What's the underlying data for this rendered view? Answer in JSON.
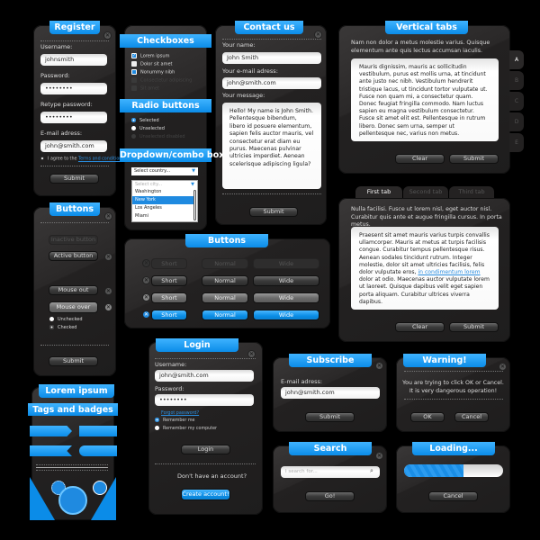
{
  "register": {
    "title": "Register",
    "username_label": "Username:",
    "username_value": "johnsmith",
    "password_label": "Password:",
    "password_value": "••••••••",
    "retype_label": "Retype password:",
    "retype_value": "••••••••",
    "email_label": "E-mail adress:",
    "email_value": "john@smith.com",
    "agree_text": "I agree to the",
    "terms_link": "Terms and conditions",
    "submit": "Submit"
  },
  "checkboxes": {
    "title": "Checkboxes",
    "items": [
      {
        "label": "Lorem ipsum",
        "checked": true,
        "disabled": false
      },
      {
        "label": "Dolor sit amet",
        "checked": false,
        "disabled": false
      },
      {
        "label": "Nonummy nibh",
        "checked": "partial",
        "disabled": false
      },
      {
        "label": "Consectetur adipiscing",
        "checked": false,
        "disabled": true
      },
      {
        "label": "Sit amet",
        "checked": true,
        "disabled": true
      }
    ]
  },
  "radios": {
    "title": "Radio buttons",
    "items": [
      {
        "label": "Selected",
        "selected": true,
        "disabled": false
      },
      {
        "label": "Unselected",
        "selected": false,
        "disabled": false
      },
      {
        "label": "Unselected disabled",
        "selected": false,
        "disabled": true
      }
    ]
  },
  "dropdown": {
    "title": "Dropdown/combo box",
    "country_value": "Select country...",
    "city_placeholder": "Select city...",
    "options": [
      "Washington",
      "New York",
      "Los Angeles",
      "Miami"
    ],
    "selected_option": "New York"
  },
  "contact": {
    "title": "Contact us",
    "name_label": "Your name:",
    "name_value": "John Smith",
    "email_label": "Your e-mail adress:",
    "email_value": "john@smith.com",
    "message_label": "Your message:",
    "message_value": "Hello! My name is John Smith. Pellentesque bibendum, libero id posuere elementum, sapien felis auctor mauris, vel consectetur erat diam eu purus. Maecenas pulvinar ultricies imperdiet. Aenean scelerisque adipiscing ligula?",
    "submit": "Submit"
  },
  "vertical_tabs": {
    "title": "Vertical tabs",
    "intro": "Nam non dolor a metus molestie varius. Quisque elementum ante quis lectus accumsan iaculis.",
    "body": "Mauris dignissim, mauris ac sollicitudin vestibulum, purus est mollis urna, at tincidunt ante justo nec nibh. Vestibulum hendrerit tristique lacus, ut tincidunt tortor vulputate ut. Fusce non quam mi, a consectetur quam. Donec feugiat fringilla commodo. Nam luctus sapien eu magna vestibulum consectetur. Fusce sit amet elit est. Pellentesque in rutrum libero. Donec sem urna, semper ut pellentesque nec, varius non metus.",
    "tabs": [
      "A",
      "B",
      "C",
      "D",
      "E"
    ],
    "active_tab": "A",
    "clear": "Clear",
    "submit": "Submit"
  },
  "horizontal_tabs": {
    "tabs": [
      "First tab",
      "Second tab",
      "Third tab"
    ],
    "active_tab": "First tab",
    "intro": "Nulla facilisi. Fusce ut lorem nisl, eget auctor nisl. Curabitur quis ante et augue fringilla cursus. In porta metus.",
    "body_before": "Praesent sit amet mauris varius turpis convallis ullamcorper. Mauris at metus at turpis facilisis congue. Curabitur tempus pellentesque risus. Aenean sodales tincidunt rutrum. Integer molestie, dolor sit amet ultricies facilisis, felis dolor vulputate eros, ",
    "body_link": "in condimentum lorem",
    "body_after": " dolor at odio. Maecenas auctor vulputate lorem ut laoreet. Quisque dapibus velit eget sapien porta aliquam. Curabitur ultrices viverra dapibus.",
    "clear": "Clear",
    "submit": "Submit"
  },
  "buttons_small": {
    "title": "Buttons",
    "inactive": "Inactive button",
    "active": "Active button",
    "mouse_out": "Mouse out",
    "mouse_over": "Mouse over",
    "unchecked": "Unchecked",
    "checked": "Checked",
    "submit": "Submit"
  },
  "buttons_grid": {
    "title": "Buttons",
    "labels": [
      "Short",
      "Normal",
      "Wide"
    ],
    "states": [
      "disabled",
      "normal",
      "hover",
      "active"
    ]
  },
  "login": {
    "title": "Login",
    "username_label": "Username:",
    "username_value": "john@smith.com",
    "password_label": "Password:",
    "password_value": "••••••••",
    "forgot": "Forgot password?",
    "remember_me": "Remember me",
    "remember_computer": "Remember my computer",
    "login_button": "Login",
    "no_account": "Don't have an account?",
    "create": "Create account!"
  },
  "subscribe": {
    "title": "Subscribe",
    "email_label": "E-mail adress:",
    "email_value": "john@smith.com",
    "submit": "Submit"
  },
  "warning": {
    "title": "Warning!",
    "message_line1": "You are trying to click OK or Cancel.",
    "message_line2": "It is very dangerous operation!",
    "ok": "OK",
    "cancel": "Cancel"
  },
  "search": {
    "title": "Search",
    "placeholder": "I search for...",
    "go": "Go!"
  },
  "loading": {
    "title": "Loading...",
    "progress_percent": 60,
    "cancel": "Cancel"
  },
  "tags": {
    "ribbon1": "Lorem ipsum",
    "ribbon2": "Tags and badges"
  },
  "colors": {
    "accent": "#0a8de6",
    "panel": "#252323",
    "background": "#000000"
  }
}
